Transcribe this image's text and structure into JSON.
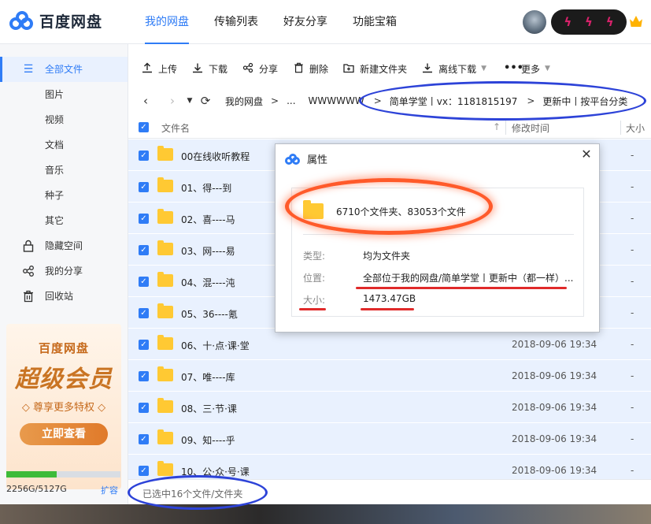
{
  "app": {
    "logo_text": "百度网盘"
  },
  "nav": [
    {
      "label": "我的网盘",
      "active": true
    },
    {
      "label": "传输列表",
      "active": false
    },
    {
      "label": "好友分享",
      "active": false
    },
    {
      "label": "功能宝箱",
      "active": false
    }
  ],
  "sidebar": {
    "items": [
      {
        "label": "全部文件",
        "icon": "file-icon",
        "active": true
      },
      {
        "label": "图片",
        "icon": "",
        "active": false
      },
      {
        "label": "视频",
        "icon": "",
        "active": false
      },
      {
        "label": "文档",
        "icon": "",
        "active": false
      },
      {
        "label": "音乐",
        "icon": "",
        "active": false
      },
      {
        "label": "种子",
        "icon": "",
        "active": false
      },
      {
        "label": "其它",
        "icon": "",
        "active": false
      },
      {
        "label": "隐藏空间",
        "icon": "lock-icon",
        "active": false
      },
      {
        "label": "我的分享",
        "icon": "share-icon",
        "active": false
      },
      {
        "label": "回收站",
        "icon": "trash-icon",
        "active": false
      }
    ],
    "promo": {
      "title": "百度网盘",
      "big": "超级会员",
      "sub": "◇ 尊享更多特权 ◇",
      "button": "立即查看"
    },
    "quota": {
      "text": "2256G/5127G",
      "expand": "扩容",
      "used_fraction": 0.44
    }
  },
  "toolbar": {
    "upload": "上传",
    "download": "下载",
    "share": "分享",
    "delete": "删除",
    "new_folder": "新建文件夹",
    "offline_download": "离线下载",
    "more": "更多"
  },
  "breadcrumb": {
    "root": "我的网盘",
    "ellipsis": "...",
    "seg1": "WWWWWW",
    "seg2": "简单学堂丨vx：1181815197",
    "seg3": "更新中丨按平台分类"
  },
  "table": {
    "col_name": "文件名",
    "col_mtime": "修改时间",
    "col_size": "大小",
    "rows": [
      {
        "name": "00在线收听教程",
        "mtime": "",
        "size": "-"
      },
      {
        "name": "01、得---到",
        "mtime": "",
        "size": "-"
      },
      {
        "name": "02、喜----马",
        "mtime": "",
        "size": "-"
      },
      {
        "name": "03、网----易",
        "mtime": "",
        "size": "-"
      },
      {
        "name": "04、混----沌",
        "mtime": "",
        "size": "-"
      },
      {
        "name": "05、36----氪",
        "mtime": "",
        "size": "-"
      },
      {
        "name": "06、十·点·课·堂",
        "mtime": "2018-09-06 19:34",
        "size": "-"
      },
      {
        "name": "07、唯----库",
        "mtime": "2018-09-06 19:34",
        "size": "-"
      },
      {
        "name": "08、三·节·课",
        "mtime": "2018-09-06 19:34",
        "size": "-"
      },
      {
        "name": "09、知----乎",
        "mtime": "2018-09-06 19:34",
        "size": "-"
      },
      {
        "name": "10、公·众·号·课",
        "mtime": "2018-09-06 19:34",
        "size": "-"
      }
    ]
  },
  "status": {
    "selection": "已选中16个文件/文件夹"
  },
  "dialog": {
    "title": "属性",
    "summary": "6710个文件夹、83053个文件",
    "type_label": "类型:",
    "type_value": "均为文件夹",
    "location_label": "位置:",
    "location_value": "全部位于我的网盘/简单学堂丨更新中（都一样）...",
    "size_label": "大小:",
    "size_value": "1473.47GB"
  },
  "colors": {
    "accent": "#2f7cf6",
    "annotation_blue": "#2d43d8",
    "annotation_red": "#ff5a2a",
    "row_selected": "#e9f1fe"
  }
}
